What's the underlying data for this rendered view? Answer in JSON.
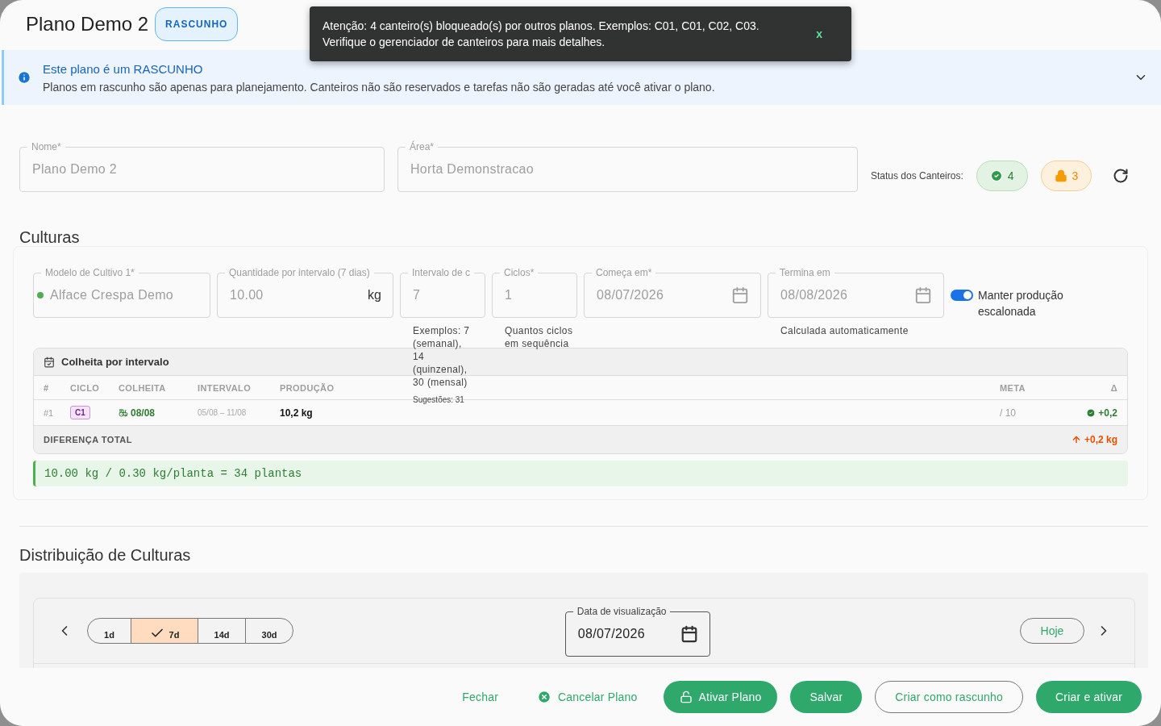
{
  "title": "Plano Demo 2",
  "status_badge": "RASCUNHO",
  "toast": {
    "lines": [
      "Atenção: 4 canteiro(s) bloqueado(s) por outros planos. Exemplos: C01, C01, C02, C03.",
      "Verifique o gerenciador de canteiros para mais detalhes."
    ],
    "close": "x"
  },
  "alert": {
    "title": "Este plano é um RASCUNHO",
    "text": "Planos em rascunho são apenas para planejamento. Canteiros não são reservados e tarefas não são geradas até você ativar o plano."
  },
  "fields": [
    {
      "label": "Nome*",
      "value": "Plano Demo 2",
      "disabled": true
    },
    {
      "label": "Área*",
      "value": "Horta Demonstracao",
      "disabled": true
    }
  ],
  "bed_status": {
    "label": "Status dos Canteiros:",
    "chips": [
      {
        "kind": "ok",
        "count": "4"
      },
      {
        "kind": "locked",
        "count": "3"
      }
    ]
  },
  "cultures": {
    "heading": "Culturas",
    "inputs": [
      {
        "kind": "select",
        "label": "Modelo de Cultivo 1*",
        "value": "Alface Crespa Demo",
        "color": "#4caf50",
        "disabled": true
      },
      {
        "kind": "number",
        "label": "Quantidade por intervalo (7 dias)",
        "value": "10.00",
        "unit": "kg",
        "disabled": true
      },
      {
        "kind": "number",
        "label": "Intervalo de c",
        "value": "7",
        "helper": "Exemplos: 7 (semanal), 14 (quinzenal), 30 (mensal)",
        "hint": "Sugestões: 31",
        "disabled": true
      },
      {
        "kind": "number",
        "label": "Ciclos*",
        "value": "1",
        "helper": "Quantos ciclos em sequência",
        "disabled": true
      },
      {
        "kind": "date",
        "label": "Começa em*",
        "value": "08/07/2026",
        "disabled": true
      },
      {
        "kind": "date",
        "label": "Termina em",
        "value": "08/08/2026",
        "helper": "Calculada automaticamente",
        "disabled": true
      }
    ],
    "staggered": {
      "label": "Manter produção escalonada",
      "on": true
    },
    "harvest_table": {
      "title": "Colheita por intervalo",
      "columns": [
        "#",
        "CICLO",
        "COLHEITA",
        "INTERVALO",
        "PRODUÇÃO",
        "META",
        "Δ"
      ],
      "rows": [
        {
          "index": "#1",
          "cycle": "C1",
          "harvest": "08/08",
          "interval": "05/08 – 11/08",
          "production": "10,2 kg",
          "target": "/ 10",
          "delta": "+0,2",
          "on_target": true
        }
      ],
      "total": {
        "label": "DIFERENÇA TOTAL",
        "value": "+0,2 kg"
      }
    },
    "formula": "10.00 kg / 0.30 kg/planta = 34 plantas"
  },
  "distribution": {
    "heading": "Distribuição de Culturas",
    "ranges": [
      {
        "label": "1d",
        "selected": false
      },
      {
        "label": "7d",
        "selected": true
      },
      {
        "label": "14d",
        "selected": false
      },
      {
        "label": "30d",
        "selected": false
      }
    ],
    "date_field": {
      "label": "Data de visualização",
      "value": "08/07/2026"
    },
    "today_button": "Hoje"
  },
  "footer_buttons": [
    {
      "kind": "text",
      "label": "Fechar"
    },
    {
      "kind": "text-cancel",
      "label": "Cancelar Plano"
    },
    {
      "kind": "filled-lock",
      "label": "Ativar Plano"
    },
    {
      "kind": "filled",
      "label": "Salvar"
    },
    {
      "kind": "outlined",
      "label": "Criar como rascunho"
    },
    {
      "kind": "filled",
      "label": "Criar e ativar"
    }
  ]
}
